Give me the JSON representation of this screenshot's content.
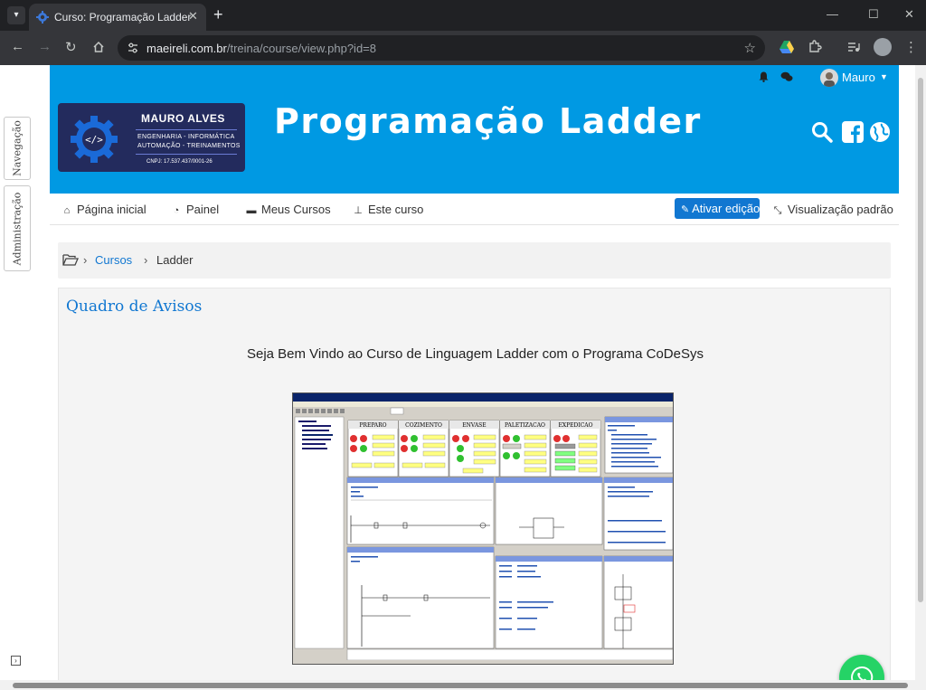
{
  "browser": {
    "tab_title": "Curso: Programação Ladder",
    "url_host": "maeireli.com.br",
    "url_path": "/treina/course/view.php?id=8"
  },
  "drawer": {
    "nav_label": "Navegação",
    "admin_label": "Administração"
  },
  "topbar": {
    "user_name": "Mauro"
  },
  "header": {
    "logo": {
      "name": "MAURO ALVES",
      "line1": "ENGENHARIA - INFORMÁTICA",
      "line2": "AUTOMAÇÃO - TREINAMENTOS",
      "cnpj": "CNPJ: 17.537.437/0001-26"
    },
    "site_title": "Programação Ladder"
  },
  "nav": {
    "home": "Página inicial",
    "dashboard": "Painel",
    "my_courses": "Meus Cursos",
    "this_course": "Este curso",
    "edit_button": "Ativar edição",
    "default_view": "Visualização padrão"
  },
  "breadcrumb": {
    "items": [
      "Cursos",
      "Ladder"
    ]
  },
  "block": {
    "title": "Quadro de Avisos",
    "welcome": "Seja Bem Vindo ao Curso de Linguagem Ladder com o Programa CoDeSys"
  },
  "codesys": {
    "panels": [
      "PREPARO",
      "COZIMENTO",
      "ENVASE",
      "PALETIZACAO",
      "EXPEDICAO"
    ]
  },
  "colors": {
    "brand_blue": "#0099e3",
    "link_blue": "#1177d1",
    "logo_navy": "#232b5d",
    "whatsapp_green": "#25d366"
  }
}
